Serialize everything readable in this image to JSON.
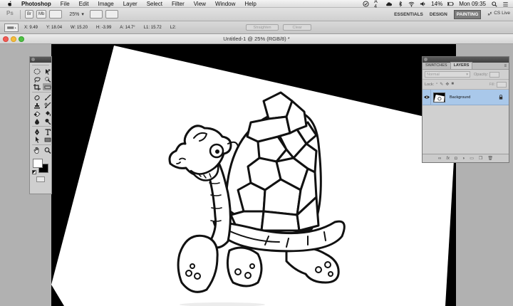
{
  "menubar": {
    "app_name": "Photoshop",
    "items": [
      "File",
      "Edit",
      "Image",
      "Layer",
      "Select",
      "Filter",
      "View",
      "Window",
      "Help"
    ],
    "battery": "14%",
    "clock": "Mon 09:35",
    "input_source": "A 4"
  },
  "appbar": {
    "logo": "Ps",
    "zoom": "25%",
    "workspaces": [
      "ESSENTIALS",
      "DESIGN",
      "PAINTING"
    ],
    "active_workspace": "PAINTING",
    "more": "»",
    "cs_live": "CS Live"
  },
  "options": {
    "x": "X: 9.49",
    "y": "Y: 18.04",
    "w": "W: 15.20",
    "h": "H: -3.99",
    "a": "A: 14.7°",
    "l1": "L1: 15.72",
    "l2": "L2:",
    "straighten": "Straighten",
    "clear": "Clear"
  },
  "document": {
    "title": "Untitled-1 @ 25% (RGB/8) *"
  },
  "layers_panel": {
    "tabs": [
      "SWATCHES",
      "LAYERS"
    ],
    "active_tab": "LAYERS",
    "blend_mode": "Normal",
    "opacity_label": "Opacity:",
    "lock_label": "Lock:",
    "fill_label": "Fill:",
    "layers": [
      {
        "name": "Background",
        "selected": true,
        "locked": true,
        "visible": true
      }
    ],
    "footer_icons": [
      "link-icon",
      "fx-icon",
      "mask-icon",
      "adjustment-icon",
      "group-icon",
      "new-layer-icon",
      "trash-icon"
    ]
  },
  "colors": {
    "foreground": "#ffffff",
    "background": "#000000",
    "selected_layer": "#a9c8ea"
  }
}
